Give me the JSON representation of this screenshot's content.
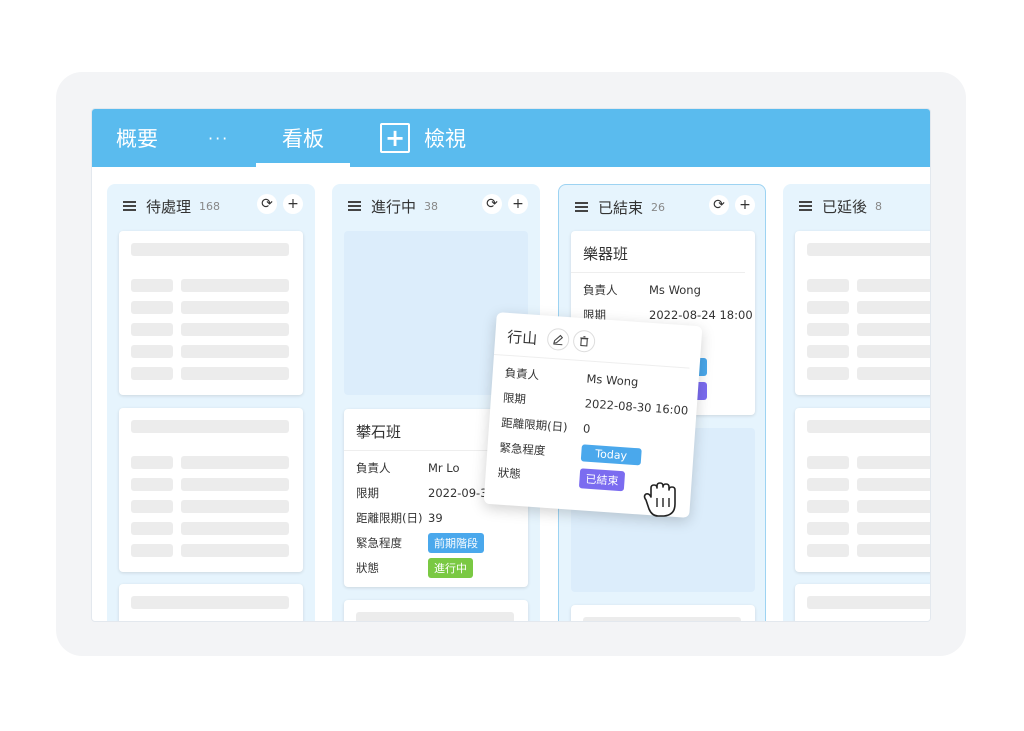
{
  "tabs": {
    "overview": "概要",
    "more": "···",
    "board": "看板",
    "view": "檢視",
    "add_symbol": "+"
  },
  "columns": [
    {
      "name": "待處理",
      "count": "168"
    },
    {
      "name": "進行中",
      "count": "38"
    },
    {
      "name": "已結束",
      "count": "26"
    },
    {
      "name": "已延後",
      "count": "8"
    }
  ],
  "col_buttons": {
    "refresh": "⟳",
    "add": "+"
  },
  "card_climb": {
    "title": "攀石班",
    "labels": {
      "owner": "負責人",
      "deadline": "限期",
      "days": "距離限期(日)",
      "urgency": "緊急程度",
      "status": "狀態"
    },
    "owner": "Mr Lo",
    "deadline": "2022-09-3",
    "days": "39",
    "urgency": "前期階段",
    "status": "進行中"
  },
  "card_music": {
    "title": "樂器班",
    "labels": {
      "owner": "負責人",
      "deadline": "限期"
    },
    "owner": "Ms Wong",
    "deadline": "2022-08-24 18:00"
  },
  "card_hike": {
    "title": "行山",
    "labels": {
      "owner": "負責人",
      "deadline": "限期",
      "days": "距離限期(日)",
      "urgency": "緊急程度",
      "status": "狀態"
    },
    "owner": "Ms Wong",
    "deadline": "2022-08-30 16:00",
    "days": "0",
    "urgency": "Today",
    "status": "已結束"
  },
  "colors": {
    "topbar": "#5abbee",
    "tag_blue": "#4aa8ec",
    "tag_green": "#7ac943",
    "tag_purple": "#7b6cf0",
    "column_bg": "#e6f4fd"
  }
}
